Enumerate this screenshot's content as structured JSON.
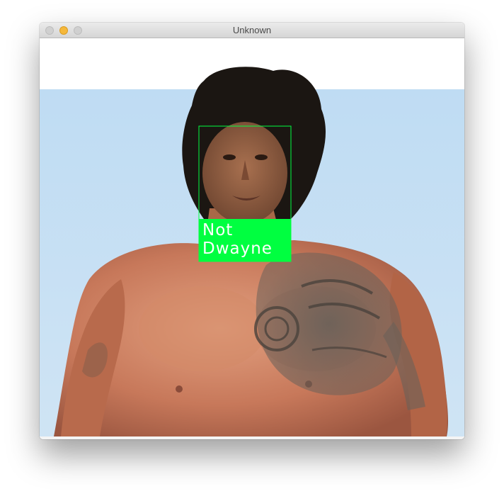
{
  "window": {
    "title": "Unknown",
    "traffic_lights": {
      "close": "close-button",
      "minimize": "minimize-button",
      "zoom": "zoom-button"
    }
  },
  "detection": {
    "label_line1": "Not",
    "label_line2": "Dwayne",
    "box_color": "#00ff40"
  },
  "colors": {
    "sky": "#c2ddf2",
    "skin": "#c98063",
    "hair": "#1b1612"
  }
}
